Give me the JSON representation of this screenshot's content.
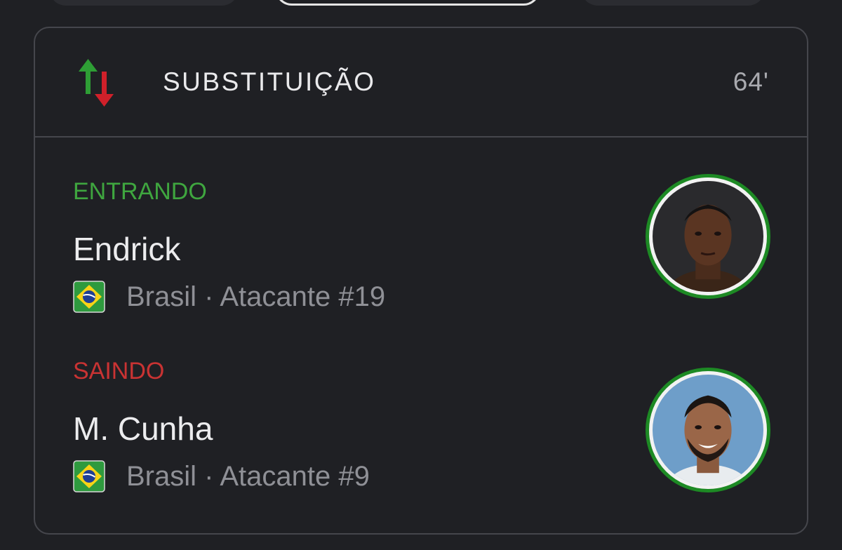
{
  "card": {
    "title": "SUBSTITUIÇÃO",
    "minute": "64'",
    "icon": "substitution-arrows-icon"
  },
  "player_in": {
    "status": "ENTRANDO",
    "name": "Endrick",
    "meta": "Brasil · Atacante #19",
    "flag": "brazil-flag-icon",
    "status_color": "#3fa63f"
  },
  "player_out": {
    "status": "SAINDO",
    "name": "M. Cunha",
    "meta": "Brasil · Atacante #9",
    "flag": "brazil-flag-icon",
    "status_color": "#c93333"
  },
  "colors": {
    "background": "#1f2024",
    "border": "#45464c",
    "avatar_ring": "#1d8a24",
    "arrow_up": "#2e9e35",
    "arrow_down": "#d0202a"
  }
}
